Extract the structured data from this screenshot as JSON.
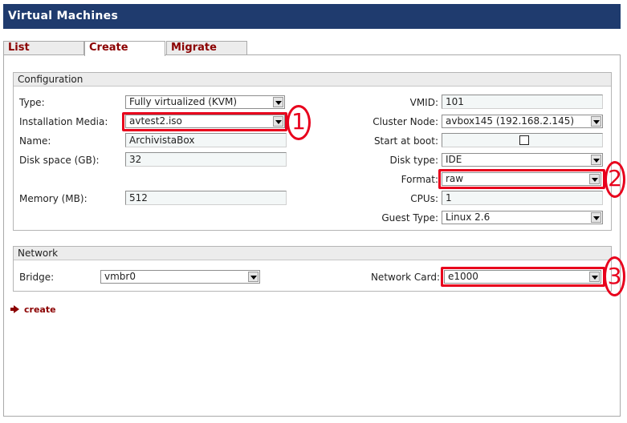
{
  "window": {
    "title": "Virtual Machines"
  },
  "tabs": [
    {
      "label": "List",
      "active": false
    },
    {
      "label": "Create",
      "active": true
    },
    {
      "label": "Migrate",
      "active": false
    }
  ],
  "configuration": {
    "legend": "Configuration",
    "type": {
      "label": "Type:",
      "value": "Fully virtualized (KVM)"
    },
    "installation_media": {
      "label": "Installation Media:",
      "value": "avtest2.iso"
    },
    "name": {
      "label": "Name:",
      "value": "ArchivistaBox"
    },
    "disk_space": {
      "label": "Disk space (GB):",
      "value": "32"
    },
    "memory": {
      "label": "Memory (MB):",
      "value": "512"
    },
    "vmid": {
      "label": "VMID:",
      "value": "101"
    },
    "cluster_node": {
      "label": "Cluster Node:",
      "value": "avbox145 (192.168.2.145)"
    },
    "start_at_boot": {
      "label": "Start at boot:",
      "checked": false
    },
    "disk_type": {
      "label": "Disk type:",
      "value": "IDE"
    },
    "format": {
      "label": "Format:",
      "value": "raw"
    },
    "cpus": {
      "label": "CPUs:",
      "value": "1"
    },
    "guest_type": {
      "label": "Guest Type:",
      "value": "Linux 2.6"
    }
  },
  "network": {
    "legend": "Network",
    "bridge": {
      "label": "Bridge:",
      "value": "vmbr0"
    },
    "network_card": {
      "label": "Network Card:",
      "value": "e1000"
    }
  },
  "actions": {
    "create_label": "create"
  },
  "annotations": {
    "one": "1",
    "two": "2",
    "three": "3"
  },
  "colors": {
    "title_bg": "#1f3b6e",
    "accent": "#8b0000",
    "highlight": "#e8001c"
  }
}
